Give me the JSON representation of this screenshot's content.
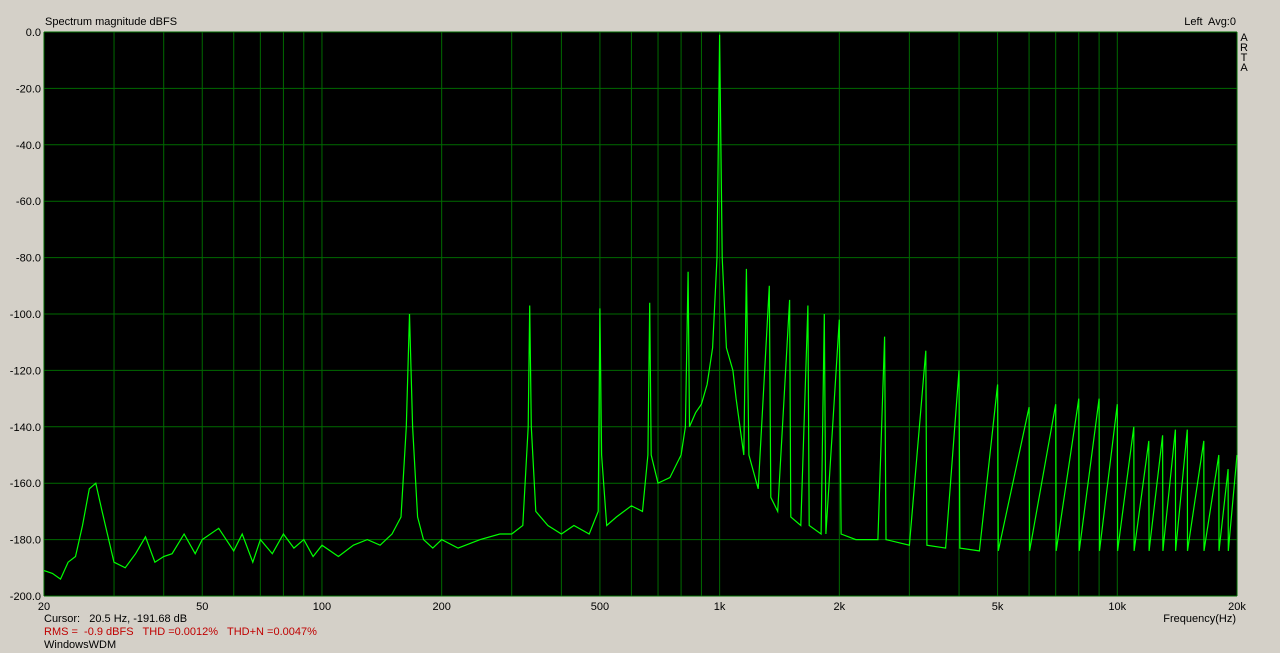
{
  "app": {
    "logo_text": "ARTA"
  },
  "header": {
    "title": "Spectrum magnitude dBFS",
    "meta": "Left  Avg:0"
  },
  "footer": {
    "cursor_label": "Cursor:",
    "cursor_value": "20.5 Hz, -191.68 dB",
    "stats": "RMS =  -0.9 dBFS   THD =0.0012%   THD+N =0.0047%",
    "driver": "WindowsWDM"
  },
  "colors": {
    "plot_bg": "#000000",
    "grid": "#006a00",
    "trace": "#00ff00",
    "window_bg": "#d4d0c8",
    "stats_text": "#c00000"
  },
  "chart_data": {
    "type": "line",
    "title": "Spectrum magnitude dBFS",
    "xlabel": "Frequency(Hz)",
    "ylabel": "",
    "xscale": "log",
    "xlim": [
      20,
      20000
    ],
    "ylim": [
      -200,
      0
    ],
    "grid": true,
    "x_ticks": [
      {
        "v": 20,
        "label": "20"
      },
      {
        "v": 50,
        "label": "50"
      },
      {
        "v": 100,
        "label": "100"
      },
      {
        "v": 200,
        "label": "200"
      },
      {
        "v": 500,
        "label": "500"
      },
      {
        "v": 1000,
        "label": "1k"
      },
      {
        "v": 2000,
        "label": "2k"
      },
      {
        "v": 5000,
        "label": "5k"
      },
      {
        "v": 10000,
        "label": "10k"
      },
      {
        "v": 20000,
        "label": "20k"
      }
    ],
    "y_ticks": [
      {
        "v": 0,
        "label": "0.0"
      },
      {
        "v": -20,
        "label": "-20.0"
      },
      {
        "v": -40,
        "label": "-40.0"
      },
      {
        "v": -60,
        "label": "-60.0"
      },
      {
        "v": -80,
        "label": "-80.0"
      },
      {
        "v": -100,
        "label": "-100.0"
      },
      {
        "v": -120,
        "label": "-120.0"
      },
      {
        "v": -140,
        "label": "-140.0"
      },
      {
        "v": -160,
        "label": "-160.0"
      },
      {
        "v": -180,
        "label": "-180.0"
      },
      {
        "v": -200,
        "label": "-200.0"
      }
    ],
    "series": [
      {
        "values_xy": [
          [
            20,
            -191
          ],
          [
            21,
            -192
          ],
          [
            22,
            -194
          ],
          [
            23,
            -188
          ],
          [
            24,
            -186
          ],
          [
            25,
            -175
          ],
          [
            26,
            -162
          ],
          [
            27,
            -160
          ],
          [
            28,
            -170
          ],
          [
            30,
            -188
          ],
          [
            32,
            -190
          ],
          [
            34,
            -185
          ],
          [
            36,
            -179
          ],
          [
            38,
            -188
          ],
          [
            40,
            -186
          ],
          [
            42,
            -185
          ],
          [
            45,
            -178
          ],
          [
            48,
            -185
          ],
          [
            50,
            -180
          ],
          [
            55,
            -176
          ],
          [
            60,
            -184
          ],
          [
            63,
            -178
          ],
          [
            67,
            -188
          ],
          [
            70,
            -180
          ],
          [
            75,
            -185
          ],
          [
            80,
            -178
          ],
          [
            85,
            -183
          ],
          [
            90,
            -180
          ],
          [
            95,
            -186
          ],
          [
            100,
            -182
          ],
          [
            110,
            -186
          ],
          [
            120,
            -182
          ],
          [
            130,
            -180
          ],
          [
            140,
            -182
          ],
          [
            150,
            -178
          ],
          [
            158,
            -172
          ],
          [
            163,
            -140
          ],
          [
            166,
            -100
          ],
          [
            169,
            -140
          ],
          [
            174,
            -172
          ],
          [
            180,
            -180
          ],
          [
            190,
            -183
          ],
          [
            200,
            -180
          ],
          [
            220,
            -183
          ],
          [
            250,
            -180
          ],
          [
            280,
            -178
          ],
          [
            300,
            -178
          ],
          [
            320,
            -175
          ],
          [
            330,
            -140
          ],
          [
            333,
            -97
          ],
          [
            336,
            -140
          ],
          [
            345,
            -170
          ],
          [
            370,
            -175
          ],
          [
            400,
            -178
          ],
          [
            430,
            -175
          ],
          [
            470,
            -178
          ],
          [
            495,
            -170
          ],
          [
            500,
            -98
          ],
          [
            505,
            -150
          ],
          [
            520,
            -175
          ],
          [
            550,
            -172
          ],
          [
            600,
            -168
          ],
          [
            640,
            -170
          ],
          [
            660,
            -150
          ],
          [
            667,
            -96
          ],
          [
            673,
            -150
          ],
          [
            700,
            -160
          ],
          [
            750,
            -158
          ],
          [
            800,
            -150
          ],
          [
            820,
            -140
          ],
          [
            833,
            -85
          ],
          [
            840,
            -140
          ],
          [
            870,
            -135
          ],
          [
            900,
            -132
          ],
          [
            930,
            -125
          ],
          [
            960,
            -112
          ],
          [
            985,
            -80
          ],
          [
            1000,
            -1
          ],
          [
            1015,
            -80
          ],
          [
            1040,
            -112
          ],
          [
            1080,
            -120
          ],
          [
            1100,
            -130
          ],
          [
            1150,
            -150
          ],
          [
            1168,
            -84
          ],
          [
            1185,
            -150
          ],
          [
            1250,
            -162
          ],
          [
            1333,
            -90
          ],
          [
            1345,
            -165
          ],
          [
            1400,
            -170
          ],
          [
            1500,
            -95
          ],
          [
            1510,
            -172
          ],
          [
            1600,
            -175
          ],
          [
            1667,
            -97
          ],
          [
            1680,
            -175
          ],
          [
            1800,
            -178
          ],
          [
            1833,
            -100
          ],
          [
            1850,
            -178
          ],
          [
            2000,
            -102
          ],
          [
            2020,
            -178
          ],
          [
            2200,
            -180
          ],
          [
            2500,
            -180
          ],
          [
            2600,
            -108
          ],
          [
            2620,
            -180
          ],
          [
            3000,
            -182
          ],
          [
            3300,
            -113
          ],
          [
            3320,
            -182
          ],
          [
            3700,
            -183
          ],
          [
            4000,
            -120
          ],
          [
            4020,
            -183
          ],
          [
            4500,
            -184
          ],
          [
            5000,
            -125
          ],
          [
            5020,
            -184
          ],
          [
            6000,
            -133
          ],
          [
            6020,
            -184
          ],
          [
            7000,
            -132
          ],
          [
            7020,
            -184
          ],
          [
            8000,
            -130
          ],
          [
            8020,
            -184
          ],
          [
            9000,
            -130
          ],
          [
            9020,
            -184
          ],
          [
            10000,
            -132
          ],
          [
            10020,
            -184
          ],
          [
            11000,
            -140
          ],
          [
            11020,
            -184
          ],
          [
            12000,
            -145
          ],
          [
            12020,
            -184
          ],
          [
            13000,
            -143
          ],
          [
            13020,
            -184
          ],
          [
            14000,
            -141
          ],
          [
            14020,
            -184
          ],
          [
            15000,
            -141
          ],
          [
            15020,
            -184
          ],
          [
            16500,
            -145
          ],
          [
            16520,
            -184
          ],
          [
            18000,
            -150
          ],
          [
            18020,
            -184
          ],
          [
            19000,
            -155
          ],
          [
            19020,
            -184
          ],
          [
            20000,
            -150
          ]
        ]
      }
    ]
  }
}
